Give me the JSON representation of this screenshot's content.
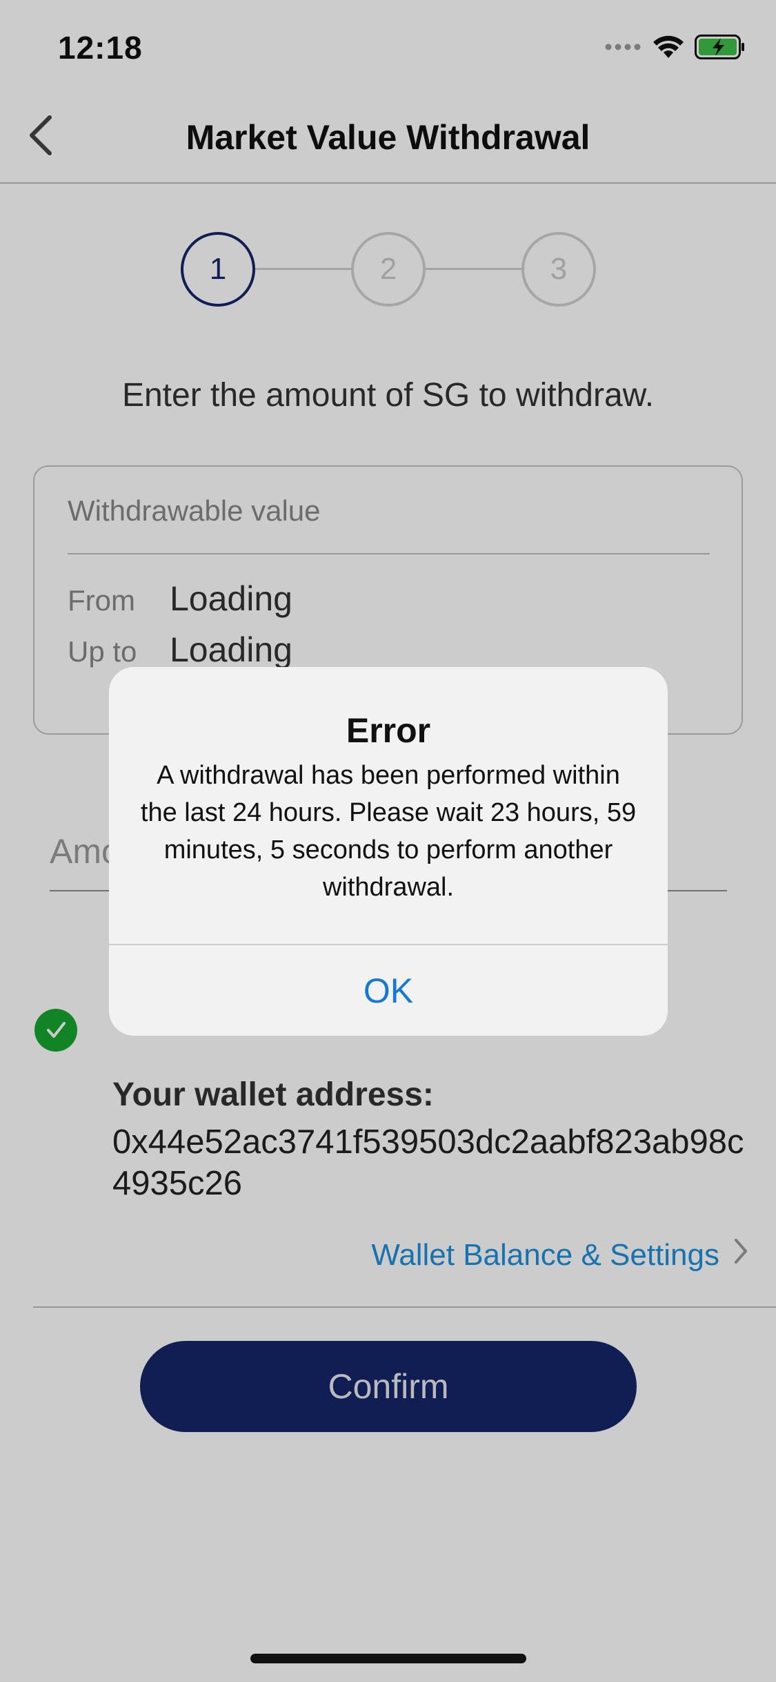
{
  "status_bar": {
    "time": "12:18"
  },
  "nav": {
    "title": "Market Value Withdrawal",
    "back_icon": "chevron-left-icon"
  },
  "stepper": {
    "steps": [
      "1",
      "2",
      "3"
    ],
    "active_step": 1,
    "active_color": "#16266a"
  },
  "instruction": "Enter the amount of SG to withdraw.",
  "withdrawable_card": {
    "title": "Withdrawable value",
    "rows": [
      {
        "label": "From",
        "value": "Loading"
      },
      {
        "label": "Up to",
        "value": "Loading"
      }
    ]
  },
  "amount_field": {
    "placeholder": "Amount",
    "value": ""
  },
  "wallet": {
    "check_icon": "checkmark-circle-icon",
    "check_color": "#16a52f",
    "label": "Your wallet address:",
    "address": "0x44e52ac3741f539503dc2aabf823ab98c4935c26",
    "link_label": "Wallet Balance & Settings",
    "link_icon": "chevron-right-icon",
    "link_color": "#1d8fdc"
  },
  "confirm_button": {
    "label": "Confirm",
    "color": "#16266a"
  },
  "alert": {
    "title": "Error",
    "message": "A withdrawal has been performed within the last 24 hours. Please wait 23 hours, 59 minutes, 5 seconds to perform another withdrawal.",
    "ok_label": "OK",
    "ok_color": "#1478d4"
  }
}
